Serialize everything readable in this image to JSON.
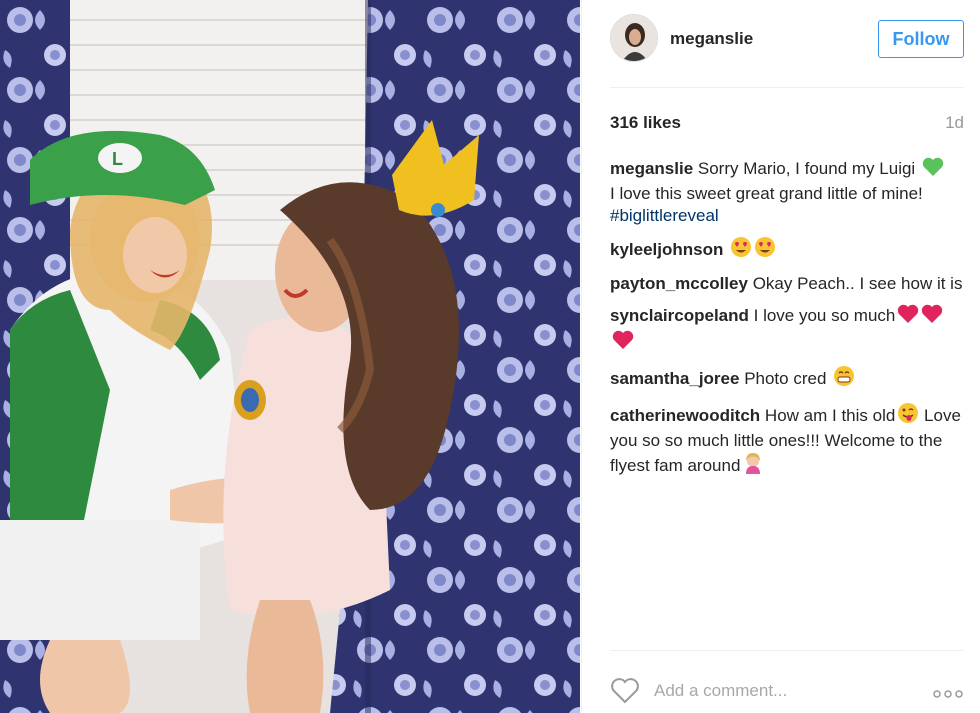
{
  "post": {
    "photo_alt": "",
    "username": "meganslie",
    "follow_label": "Follow",
    "likes": "316 likes",
    "time": "1d"
  },
  "caption": {
    "user": "meganslie",
    "text": "Sorry Mario, I found my Luigi",
    "emoji": "green-heart-icon",
    "text2": "I love this sweet great grand little of mine!",
    "hashtag": "#biglittlereveal"
  },
  "comments": [
    {
      "user": "kyleeljohnson",
      "text": "",
      "emojis": [
        "heart-eyes-icon",
        "heart-eyes-icon"
      ]
    },
    {
      "user": "payton_mccolley",
      "text": "Okay Peach.. I see how it is",
      "emojis": []
    },
    {
      "user": "synclaircopeland",
      "text": "I love you so much",
      "emojis": [
        "red-heart-icon",
        "red-heart-icon",
        "red-heart-icon"
      ]
    },
    {
      "user": "samantha_joree",
      "text": "Photo cred",
      "emojis": [
        "grin-icon"
      ]
    },
    {
      "user": "catherinewooditch",
      "text": "How am I this old",
      "text_b": "Love you so so much little ones!!! Welcome to the flyest fam around",
      "emojis": [
        "wink-tongue-icon",
        "tipping-hand-icon"
      ]
    }
  ],
  "add_comment": {
    "placeholder": "Add a comment..."
  },
  "colors": {
    "accent": "#3897f0",
    "hashtag": "#003569",
    "muted": "#999999"
  }
}
